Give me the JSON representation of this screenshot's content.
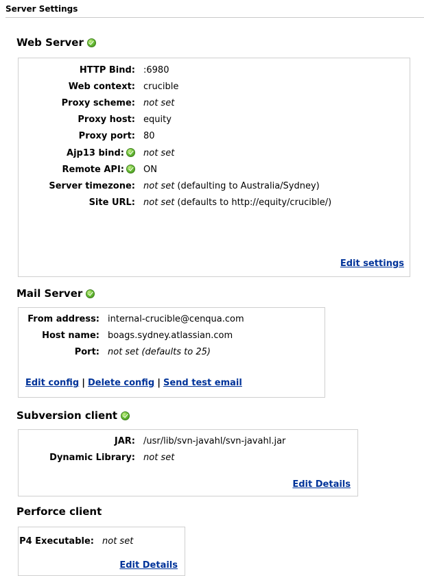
{
  "page_title": "Server Settings",
  "web_server": {
    "title": "Web Server",
    "rows": {
      "http_bind": {
        "label": "HTTP Bind:",
        "value": ":6980"
      },
      "web_context": {
        "label": "Web context:",
        "value": "crucible"
      },
      "proxy_scheme": {
        "label": "Proxy scheme:",
        "value": "not set"
      },
      "proxy_host": {
        "label": "Proxy host:",
        "value": "equity"
      },
      "proxy_port": {
        "label": "Proxy port:",
        "value": "80"
      },
      "ajp13_bind": {
        "label": "Ajp13 bind:",
        "value": "not set"
      },
      "remote_api": {
        "label": "Remote API:",
        "value": "ON"
      },
      "server_timezone": {
        "label": "Server timezone:",
        "value": "not set",
        "note": " (defaulting to Australia/Sydney)"
      },
      "site_url": {
        "label": "Site URL:",
        "value": "not set",
        "note": " (defaults to http://equity/crucible/)"
      }
    },
    "edit_link": "Edit settings"
  },
  "mail_server": {
    "title": "Mail Server",
    "rows": {
      "from_address": {
        "label": "From address:",
        "value": "internal-crucible@cenqua.com"
      },
      "host_name": {
        "label": "Host name:",
        "value": "boags.sydney.atlassian.com"
      },
      "port": {
        "label": "Port:",
        "value": "not set (defaults to 25)"
      }
    },
    "links": {
      "edit": "Edit config",
      "delete": "Delete config",
      "test": "Send test email",
      "separator": "|"
    }
  },
  "svn_client": {
    "title": "Subversion client",
    "rows": {
      "jar": {
        "label": "JAR:",
        "value": "/usr/lib/svn-javahl/svn-javahl.jar"
      },
      "dynamic_library": {
        "label": "Dynamic Library:",
        "value": "not set"
      }
    },
    "edit_link": "Edit Details"
  },
  "perforce_client": {
    "title": "Perforce client",
    "rows": {
      "p4_executable": {
        "label": "P4 Executable:",
        "value": "not set"
      }
    },
    "edit_link": "Edit Details"
  },
  "icons": {
    "status": "green-check-circle-icon"
  },
  "colors": {
    "link": "#003399",
    "ok": "#6ec23a",
    "border": "#cfcfcf"
  }
}
